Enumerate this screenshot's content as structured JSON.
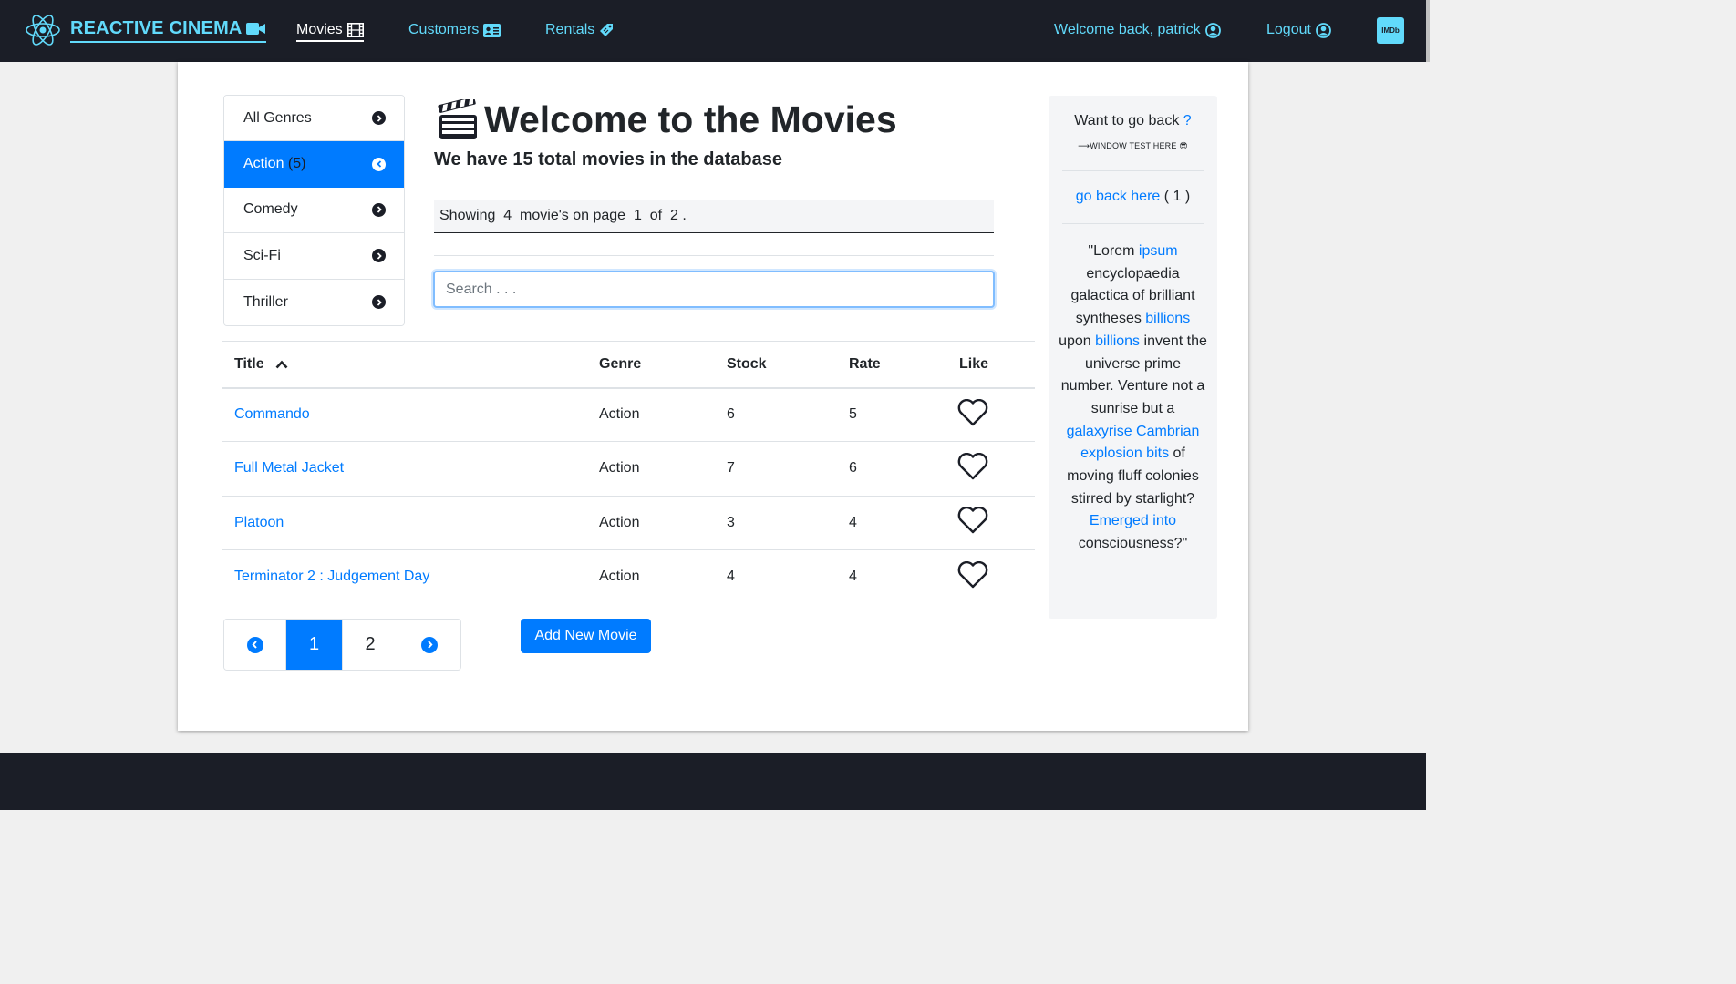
{
  "navbar": {
    "brand": "REACTIVE CINEMA",
    "links": [
      {
        "label": "Movies",
        "active": true
      },
      {
        "label": "Customers",
        "active": false
      },
      {
        "label": "Rentals",
        "active": false
      }
    ],
    "welcome": "Welcome back, patrick",
    "logout": "Logout",
    "imdb": "IMDb"
  },
  "genres": [
    {
      "label": "All Genres",
      "count": "",
      "active": false
    },
    {
      "label": "Action",
      "count": "(5)",
      "active": true
    },
    {
      "label": "Comedy",
      "count": "",
      "active": false
    },
    {
      "label": "Sci-Fi",
      "count": "",
      "active": false
    },
    {
      "label": "Thriller",
      "count": "",
      "active": false
    }
  ],
  "main": {
    "title": "Welcome to the Movies",
    "subtitle": "We have 15 total movies in the database",
    "showing": "Showing  4  movie's on page  1  of  2 .",
    "search_placeholder": "Search . . ."
  },
  "table": {
    "columns": [
      "Title",
      "Genre",
      "Stock",
      "Rate",
      "Like"
    ],
    "rows": [
      {
        "title": "Commando",
        "genre": "Action",
        "stock": "6",
        "rate": "5"
      },
      {
        "title": "Full Metal Jacket",
        "genre": "Action",
        "stock": "7",
        "rate": "6"
      },
      {
        "title": "Platoon",
        "genre": "Action",
        "stock": "3",
        "rate": "4"
      },
      {
        "title": "Terminator 2 : Judgement Day",
        "genre": "Action",
        "stock": "4",
        "rate": "4"
      }
    ]
  },
  "pagination": {
    "pages": [
      "1",
      "2"
    ],
    "current": "1"
  },
  "add_button": "Add New Movie",
  "sidebar": {
    "question": "Want to go back",
    "question_mark": "?",
    "small_note": "⟶WINDOW TEST HERE 😎",
    "go_back_link": "go back here",
    "go_back_count": "( 1 )",
    "quote_parts": [
      {
        "text": "\"Lorem ",
        "link": false
      },
      {
        "text": "ipsum",
        "link": true
      },
      {
        "text": " encyclopaedia galactica of brilliant syntheses ",
        "link": false
      },
      {
        "text": "billions",
        "link": true
      },
      {
        "text": " upon ",
        "link": false
      },
      {
        "text": "billions",
        "link": true
      },
      {
        "text": " invent the universe prime number. Venture not a sunrise but a ",
        "link": false
      },
      {
        "text": "galaxyrise Cambrian explosion bits",
        "link": true
      },
      {
        "text": " of moving fluff colonies stirred by starlight? ",
        "link": false
      },
      {
        "text": "Emerged into",
        "link": true
      },
      {
        "text": " consciousness?\"",
        "link": false
      }
    ]
  },
  "colors": {
    "navbar_bg": "#1b1e27",
    "accent": "#61dafb",
    "primary": "#007bff"
  }
}
